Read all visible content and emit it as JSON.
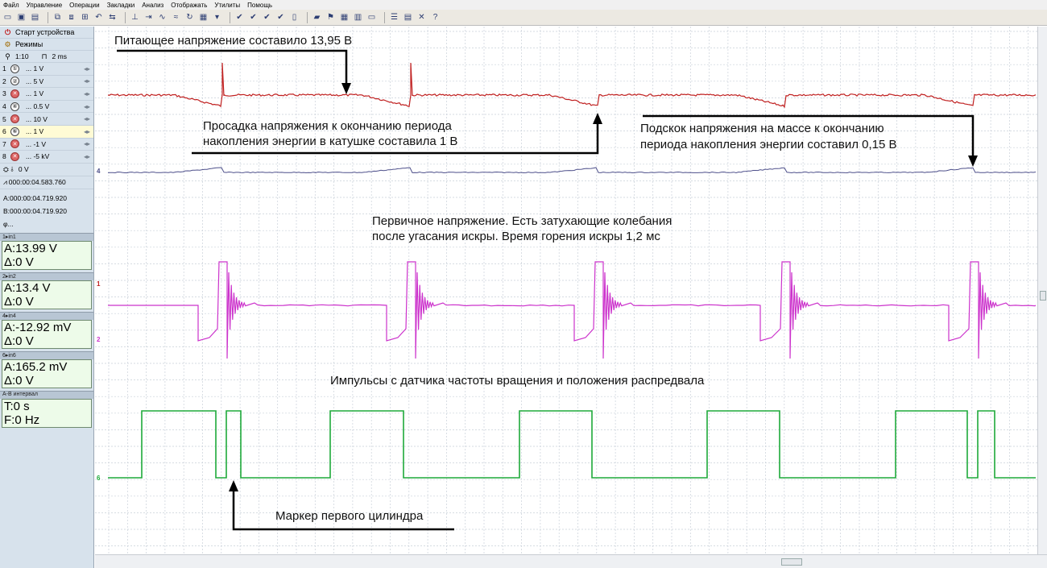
{
  "menu": [
    "Файл",
    "Управление",
    "Операции",
    "Закладки",
    "Анализ",
    "Отображать",
    "Утилиты",
    "Помощь"
  ],
  "sidebar": {
    "start_device": "Старт устройства",
    "modes": "Режимы",
    "zoom": "1:10",
    "timebase": "2 ms",
    "channels": [
      {
        "num": "1",
        "value": "... 1 V",
        "active": true
      },
      {
        "num": "2",
        "value": "... 5 V",
        "active": true
      },
      {
        "num": "3",
        "value": "... 1 V",
        "active": false
      },
      {
        "num": "4",
        "value": "... 0.5 V",
        "active": true
      },
      {
        "num": "5",
        "value": "... 10 V",
        "active": false
      },
      {
        "num": "6",
        "value": "... 1 V",
        "active": true
      },
      {
        "num": "7",
        "value": "... -1 V",
        "active": false
      },
      {
        "num": "8",
        "value": "... -5 kV",
        "active": false
      }
    ],
    "trigger": "0 V",
    "time_offset": "000:00:04.583.760",
    "cursor_a": "A:000:00:04.719.920",
    "cursor_b": "B:000:00:04.719.920",
    "phi": "φ..."
  },
  "measurements": [
    {
      "header": "1▸in1",
      "a": "A:13.99 V",
      "d": "Δ:0 V"
    },
    {
      "header": "2▸in2",
      "a": "A:13.4 V",
      "d": "Δ:0 V"
    },
    {
      "header": "4▸in4",
      "a": "A:-12.92 mV",
      "d": "Δ:0 V"
    },
    {
      "header": "6▸in6",
      "a": "A:165.2 mV",
      "d": "Δ:0 V"
    }
  ],
  "interval": {
    "header": "A-B интервал",
    "t": "T:0 s",
    "f": "F:0 Hz"
  },
  "annotations": {
    "supply": "Питающее напряжение составило 13,95 В",
    "sag_1": "Просадка напряжения к окончанию периода",
    "sag_2": "накопления энергии в катушке составила 1 В",
    "ground_1": "Подскок напряжения на массе к окончанию",
    "ground_2": "периода накопления энергии составил 0,15 В",
    "primary_1": "Первичное напряжение. Есть затухающие колебания",
    "primary_2": "после угасания искры. Время горения искры 1,2 мс",
    "sensor": "Импульсы с датчика частоты вращения и положения распредвала",
    "marker": "Маркер первого цилиндра"
  },
  "channel_labels": {
    "c4": "4",
    "c1": "1",
    "c2": "2",
    "c6": "6"
  },
  "colors": {
    "supply": "#c02020",
    "ground": "#4d4f8a",
    "primary": "#cc33cc",
    "sensor": "#1eaa3a",
    "grid": "#c9d0d9"
  }
}
